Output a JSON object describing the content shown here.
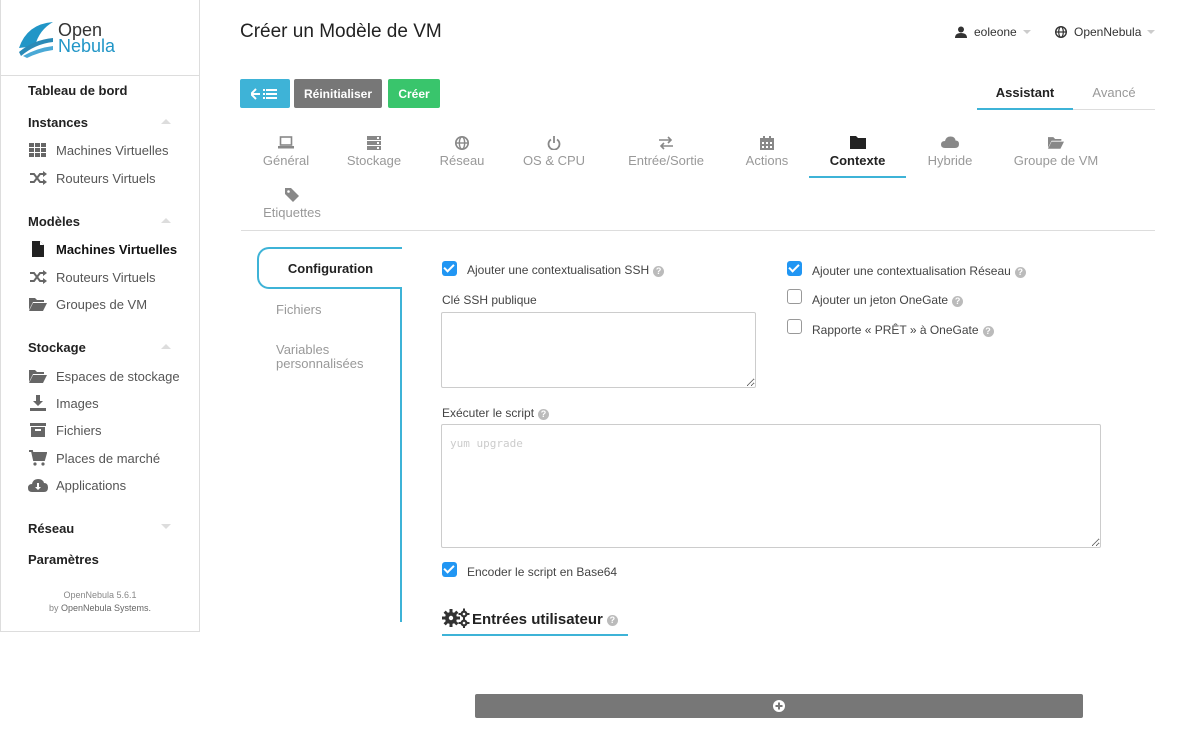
{
  "brand": {
    "line1": "Open",
    "line2": "Nebula",
    "color": "#2196c7"
  },
  "header": {
    "title": "Créer un Modèle de VM",
    "user": "eoleone",
    "zone": "OpenNebula"
  },
  "sidebar": {
    "dashboard": "Tableau de bord",
    "sections": [
      {
        "title": "Instances",
        "items": [
          "Machines Virtuelles",
          "Routeurs Virtuels"
        ]
      },
      {
        "title": "Modèles",
        "items": [
          "Machines Virtuelles",
          "Routeurs Virtuels",
          "Groupes de VM"
        ]
      },
      {
        "title": "Stockage",
        "items": [
          "Espaces de stockage",
          "Images",
          "Fichiers",
          "Places de marché",
          "Applications"
        ]
      },
      {
        "title": "Réseau",
        "items": []
      }
    ],
    "settings": "Paramètres",
    "active_item": "Machines Virtuelles",
    "footer_version": "OpenNebula 5.6.1",
    "footer_by": "by ",
    "footer_company": "OpenNebula Systems."
  },
  "toolbar": {
    "reset_label": "Réinitialiser",
    "create_label": "Créer",
    "back_icon": "arrow-list-icon",
    "accent": "#3eb3d7",
    "create_color": "#39c56c"
  },
  "mode_tabs": {
    "wizard": "Assistant",
    "advanced": "Avancé"
  },
  "section_tabs": [
    {
      "label": "Général",
      "icon": "laptop-icon"
    },
    {
      "label": "Stockage",
      "icon": "server-icon"
    },
    {
      "label": "Réseau",
      "icon": "globe-icon"
    },
    {
      "label": "OS & CPU",
      "icon": "power-icon"
    },
    {
      "label": "Entrée/Sortie",
      "icon": "exchange-icon"
    },
    {
      "label": "Actions",
      "icon": "calendar-icon"
    },
    {
      "label": "Contexte",
      "icon": "folder-icon",
      "active": true
    },
    {
      "label": "Hybride",
      "icon": "cloud-icon"
    },
    {
      "label": "Groupe de VM",
      "icon": "folder-open-icon"
    },
    {
      "label": "Etiquettes",
      "icon": "tag-icon"
    }
  ],
  "context_tabs": {
    "config": "Configuration",
    "files": "Fichiers",
    "vars_line1": "Variables",
    "vars_line2": "personnalisées"
  },
  "form": {
    "ssh_context": {
      "label": "Ajouter une contextualisation SSH",
      "checked": true
    },
    "ssh_key_label": "Clé SSH publique",
    "net_context": {
      "label": "Ajouter une contextualisation Réseau",
      "checked": true
    },
    "onegate_token": {
      "label": "Ajouter un jeton OneGate",
      "checked": false
    },
    "report_ready": {
      "label": "Rapporte « PRÊT » à OneGate",
      "checked": false
    },
    "script_label": "Exécuter le script",
    "script_placeholder": "yum upgrade",
    "base64": {
      "label": "Encoder le script en Base64",
      "checked": true
    },
    "user_inputs_title": "Entrées utilisateur"
  }
}
